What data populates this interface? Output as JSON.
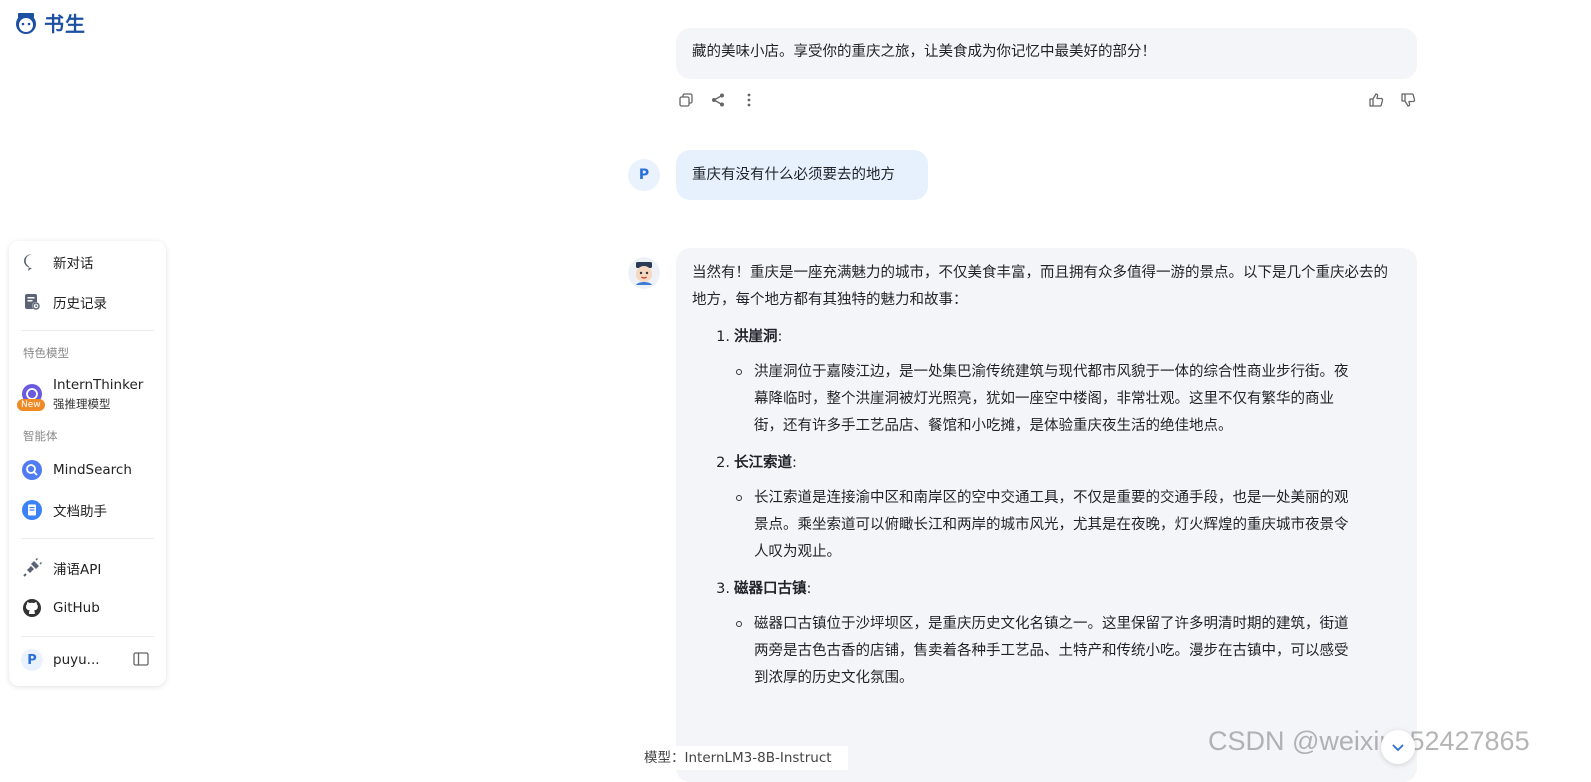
{
  "brand": {
    "name": "书生",
    "accent": "#1d4fa3"
  },
  "sidebar": {
    "new_chat": "新对话",
    "history": "历史记录",
    "section_featured": "特色模型",
    "thinker": {
      "name": "InternThinker",
      "subtitle": "强推理模型",
      "badge": "New"
    },
    "section_agents": "智能体",
    "mindsearch": "MindSearch",
    "doc_assistant": "文档助手",
    "api": "浦语API",
    "github": "GitHub",
    "user": {
      "initial": "P",
      "name": "puyu..."
    }
  },
  "chat": {
    "prev_tail": "藏的美味小店。享受你的重庆之旅，让美食成为你记忆中最美好的部分！",
    "user_message": "重庆有没有什么必须要去的地方",
    "user_initial": "P",
    "answer_intro": "当然有！重庆是一座充满魅力的城市，不仅美食丰富，而且拥有众多值得一游的景点。以下是几个重庆必去的地方，每个地方都有其独特的魅力和故事：",
    "items": [
      {
        "num": "1.",
        "title": "洪崖洞",
        "colon": ":",
        "lines": [
          "洪崖洞位于嘉陵江边，是一处集巴渝传统建筑与现代都市风貌于一体的综合性商业步行街。夜",
          "幕降临时，整个洪崖洞被灯光照亮，犹如一座空中楼阁，非常壮观。这里不仅有繁华的商业",
          "街，还有许多手工艺品店、餐馆和小吃摊，是体验重庆夜生活的绝佳地点。"
        ]
      },
      {
        "num": "2.",
        "title": "长江索道",
        "colon": ":",
        "lines": [
          "长江索道是连接渝中区和南岸区的空中交通工具，不仅是重要的交通手段，也是一处美丽的观",
          "景点。乘坐索道可以俯瞰长江和两岸的城市风光，尤其是在夜晚，灯火辉煌的重庆城市夜景令",
          "人叹为观止。"
        ]
      },
      {
        "num": "3.",
        "title": "磁器口古镇",
        "colon": ":",
        "lines": [
          "磁器口古镇位于沙坪坝区，是重庆历史文化名镇之一。这里保留了许多明清时期的建筑，街道",
          "两旁是古色古香的店铺，售卖着各种手工艺品、土特产和传统小吃。漫步在古镇中，可以感受",
          "到浓厚的历史文化氛围。"
        ]
      }
    ],
    "model_label": "模型：InternLM3-8B-Instruct"
  },
  "watermark": "CSDN @weixin_52427865"
}
